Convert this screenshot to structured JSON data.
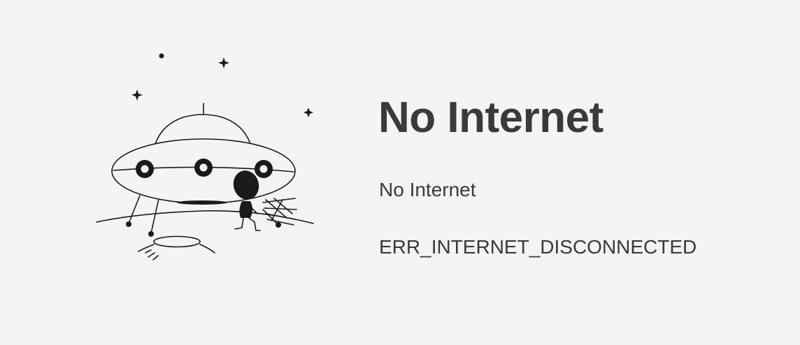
{
  "page": {
    "background": "#f4f4f4",
    "text_color": "#3a3a3a"
  },
  "illustration": {
    "icon": "ufo-alien-icon"
  },
  "message": {
    "title": "No Internet",
    "subtitle": "No Internet",
    "error_code": "ERR_INTERNET_DISCONNECTED"
  }
}
